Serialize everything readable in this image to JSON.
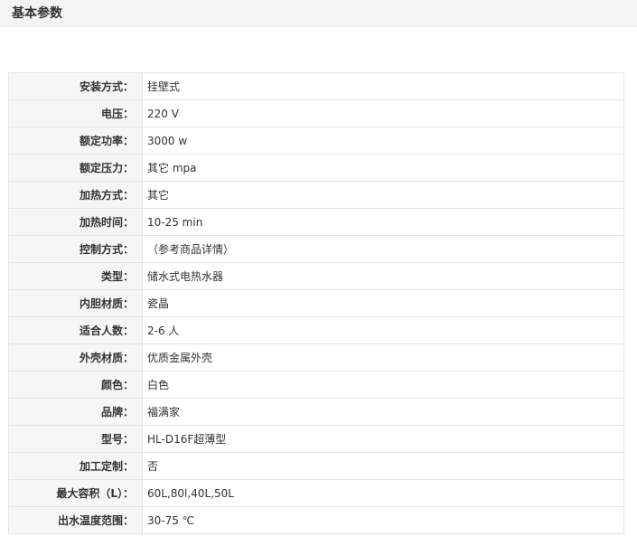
{
  "section": {
    "title": "基本参数"
  },
  "specs": [
    {
      "label": "安装方式：",
      "value": "挂壁式"
    },
    {
      "label": "电压：",
      "value": "220 V"
    },
    {
      "label": "额定功率：",
      "value": "3000 w"
    },
    {
      "label": "额定压力：",
      "value": "其它 mpa"
    },
    {
      "label": "加热方式：",
      "value": "其它"
    },
    {
      "label": "加热时间：",
      "value": "10-25 min"
    },
    {
      "label": "控制方式：",
      "value": "（参考商品详情）"
    },
    {
      "label": "类型：",
      "value": "储水式电热水器"
    },
    {
      "label": "内胆材质：",
      "value": "瓷晶"
    },
    {
      "label": "适合人数：",
      "value": "2-6 人"
    },
    {
      "label": "外壳材质：",
      "value": "优质金属外壳"
    },
    {
      "label": "颜色：",
      "value": "白色"
    },
    {
      "label": "品牌：",
      "value": "福满家"
    },
    {
      "label": "型号：",
      "value": "HL-D16F超薄型"
    },
    {
      "label": "加工定制：",
      "value": "否"
    },
    {
      "label": "最大容积（L）：",
      "value": "60L,80l,40L,50L"
    },
    {
      "label": "出水温度范围：",
      "value": "30-75 ℃"
    }
  ]
}
